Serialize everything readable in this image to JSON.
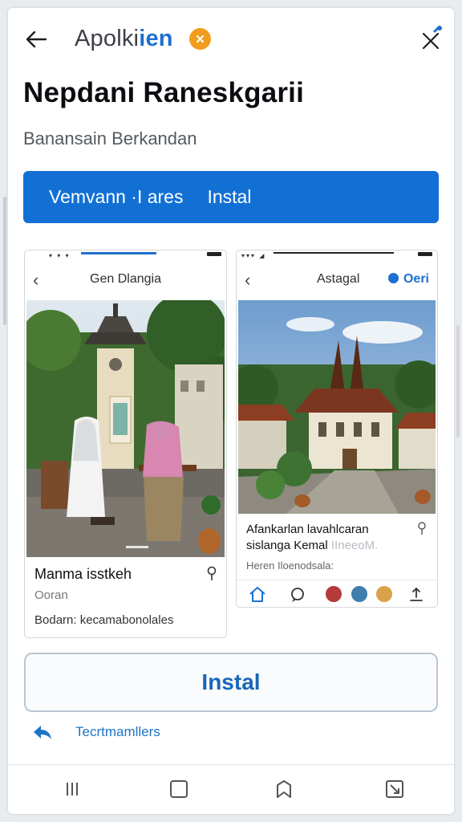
{
  "header": {
    "app_name_prefix": "Apolki",
    "app_name_accent": "ien",
    "badge_glyph": "✕"
  },
  "title": "Nepdani Raneskgarii",
  "subtitle": "Banansain Berkandan",
  "primary_button": {
    "left_text": "Vemvann ·I ares",
    "right_text": "Instal"
  },
  "screenshots": [
    {
      "nav_title": "Gen Dlangia",
      "item_title": "Manma isstkeh",
      "item_subtitle": "Ooran",
      "item_body": "Bodarn: kecamabonolales"
    },
    {
      "nav_title": "Astagal",
      "nav_link": "Oeri",
      "item_title_line1": "Afankarlan lavahlcaran",
      "item_title_line2": "sislanga Kemal",
      "item_title_faded": "IIneeoM.",
      "item_subtitle": "Heren Iloenodsala:"
    }
  ],
  "secondary_button": "Instal",
  "share_label": "Tecrtmamllers",
  "colors": {
    "primary": "#1270d4",
    "accent_orange": "#f19c1c",
    "link_blue": "#1f73c7"
  },
  "icons": [
    "back-arrow-icon",
    "close-icon",
    "pin-icon",
    "home-icon",
    "chat-icon",
    "share-icon",
    "recents-icon",
    "square-icon",
    "nav-back-icon",
    "overview-icon"
  ]
}
